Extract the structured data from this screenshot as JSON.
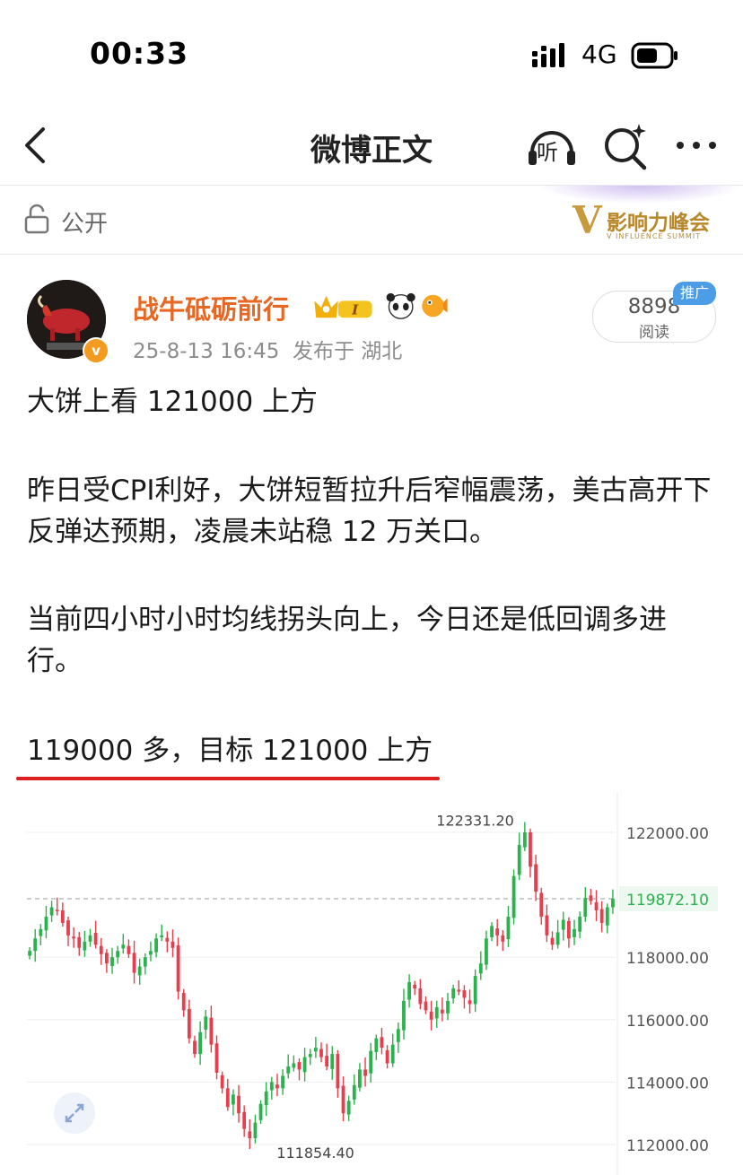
{
  "status": {
    "time": "00:33",
    "network": "4G",
    "signal_icon": "signal-bars-icon",
    "battery_icon": "battery-icon"
  },
  "nav": {
    "back_icon": "back-arrow-icon",
    "title": "微博正文",
    "listen_label": "听",
    "search_icon": "search-sparkle-icon",
    "more_icon": "more-dots-icon"
  },
  "visibility": {
    "icon": "lock-open-icon",
    "label": "公开",
    "summit_logo_text": "影响力峰会",
    "summit_logo_letter": "V",
    "summit_logo_sub": "V INFLUENCE SUMMIT"
  },
  "author": {
    "name": "战牛砥砺前行",
    "level_badge": "I",
    "verified_mark": "v",
    "time": "25-8-13 16:45",
    "location": "发布于 湖北",
    "reads": "8898",
    "reads_label": "阅读",
    "promo_tag": "推广"
  },
  "post": {
    "p1": "大饼上看 121000 上方",
    "p2": "昨日受CPI利好，大饼短暂拉升后窄幅震荡，美古高开下反弹达预期，凌晨未站稳 12 万关口。",
    "p3": "当前四小时小时均线拐头向上，今日还是低回调多进行。",
    "p4": "119000 多，目标 121000 上方"
  },
  "colors": {
    "up": "#2bb24c",
    "down": "#e63e4c",
    "author": "#e86722",
    "underline": "#e02020"
  },
  "chart_data": {
    "type": "candlestick",
    "y_ticks": [
      "122000.00",
      "119872.10",
      "118000.00",
      "116000.00",
      "114000.00",
      "112000.00"
    ],
    "ylim": [
      112000,
      122331.2
    ],
    "current_price": 119872.1,
    "high_label": "122331.20",
    "low_label": "111854.40",
    "high": 122331.2,
    "low": 111854.4,
    "closes": [
      118200,
      118600,
      118900,
      119300,
      119600,
      119500,
      119100,
      118700,
      118600,
      118300,
      118500,
      118700,
      118400,
      118100,
      117800,
      118000,
      118200,
      118400,
      118100,
      117500,
      117700,
      118000,
      118200,
      118600,
      118700,
      118500,
      118300,
      116900,
      116300,
      115400,
      114900,
      115600,
      116100,
      115200,
      114300,
      113800,
      113200,
      113600,
      113000,
      112500,
      112200,
      112700,
      113300,
      113700,
      114000,
      113800,
      114200,
      114500,
      114600,
      114400,
      114800,
      114900,
      115100,
      114800,
      114500,
      114900,
      113800,
      113000,
      113400,
      113900,
      114400,
      114200,
      115000,
      115400,
      115100,
      114600,
      115200,
      115700,
      116600,
      117200,
      117000,
      116500,
      116300,
      116000,
      116400,
      116200,
      116600,
      117000,
      116900,
      116700,
      116500,
      117400,
      117800,
      118600,
      119000,
      118700,
      118500,
      119300,
      120600,
      121600,
      122000,
      120900,
      120100,
      119300,
      118700,
      118400,
      118800,
      119200,
      118600,
      118900,
      119300,
      119900,
      119800,
      119500,
      119100,
      119600,
      119872
    ]
  }
}
